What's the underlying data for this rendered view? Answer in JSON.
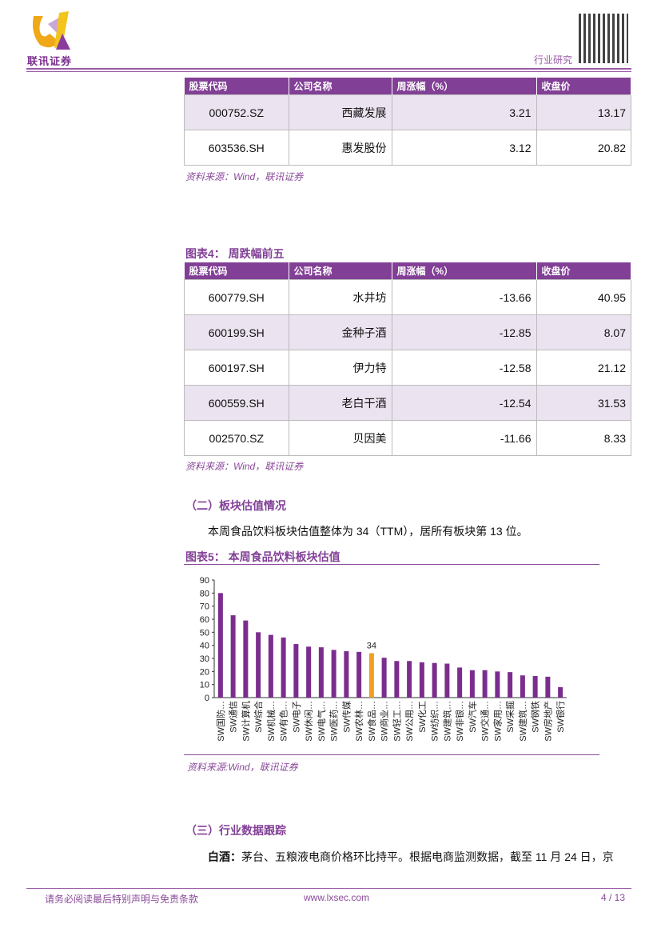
{
  "header": {
    "logo_text": "联讯证券",
    "section": "行业研究"
  },
  "table_top": {
    "headers": [
      "股票代码",
      "公司名称",
      "周涨幅（%）",
      "收盘价"
    ],
    "rows": [
      [
        "000752.SZ",
        "西藏发展",
        "3.21",
        "13.17"
      ],
      [
        "603536.SH",
        "惠发股份",
        "3.12",
        "20.82"
      ]
    ],
    "source": "资料来源：Wind，联讯证券"
  },
  "table4": {
    "title": "图表4：   周跌幅前五",
    "headers": [
      "股票代码",
      "公司名称",
      "周涨幅（%）",
      "收盘价"
    ],
    "rows": [
      [
        "600779.SH",
        "水井坊",
        "-13.66",
        "40.95"
      ],
      [
        "600199.SH",
        "金种子酒",
        "-12.85",
        "8.07"
      ],
      [
        "600197.SH",
        "伊力特",
        "-12.58",
        "21.12"
      ],
      [
        "600559.SH",
        "老白干酒",
        "-12.54",
        "31.53"
      ],
      [
        "002570.SZ",
        "贝因美",
        "-11.66",
        "8.33"
      ]
    ],
    "source": "资料来源：Wind，联讯证券"
  },
  "section2": {
    "heading": "（二）板块估值情况",
    "text": "本周食品饮料板块估值整体为 34（TTM），居所有板块第 13 位。"
  },
  "chart_title": "图表5：   本周食品饮料板块估值",
  "chart_data": {
    "type": "bar",
    "title": "本周食品饮料板块估值",
    "ylim": [
      0,
      90
    ],
    "yticks": [
      0,
      10,
      20,
      30,
      40,
      50,
      60,
      70,
      80,
      90
    ],
    "categories": [
      "SW国防…",
      "SW通信",
      "SW计算机",
      "SW综合",
      "SW机械…",
      "SW有色…",
      "SW电子",
      "SW休闲…",
      "SW电气…",
      "SW医药…",
      "SW传媒",
      "SW农林…",
      "SW食品…",
      "SW商业…",
      "SW轻工…",
      "SW公用…",
      "SW化工",
      "SW纺织…",
      "SW建筑…",
      "SW非银…",
      "SW汽车",
      "SW交通…",
      "SW家用…",
      "SW采掘",
      "SW建筑…",
      "SW钢铁",
      "SW房地产",
      "SW银行"
    ],
    "values": [
      80,
      63,
      59,
      50,
      48,
      46,
      41,
      39,
      38.5,
      36.5,
      35.5,
      35,
      34,
      30.5,
      28,
      28,
      27,
      26.5,
      26,
      23,
      21,
      21,
      20,
      19.5,
      17,
      16.5,
      16,
      8
    ],
    "highlight_index": 12,
    "highlight_label": "34",
    "colors": {
      "bar": "#7b2d8e",
      "highlight": "#f0a01e"
    }
  },
  "chart_source": "资料来源:Wind，联讯证券",
  "section3": {
    "heading": "（三）行业数据跟踪",
    "lead": "白酒：",
    "text": "茅台、五粮液电商价格环比持平。根据电商监测数据，截至 11 月 24 日，京"
  },
  "footer": {
    "disclaimer": "请务必阅读最后特别声明与免责条款",
    "url": "www.lxsec.com",
    "page": "4 / 13"
  }
}
